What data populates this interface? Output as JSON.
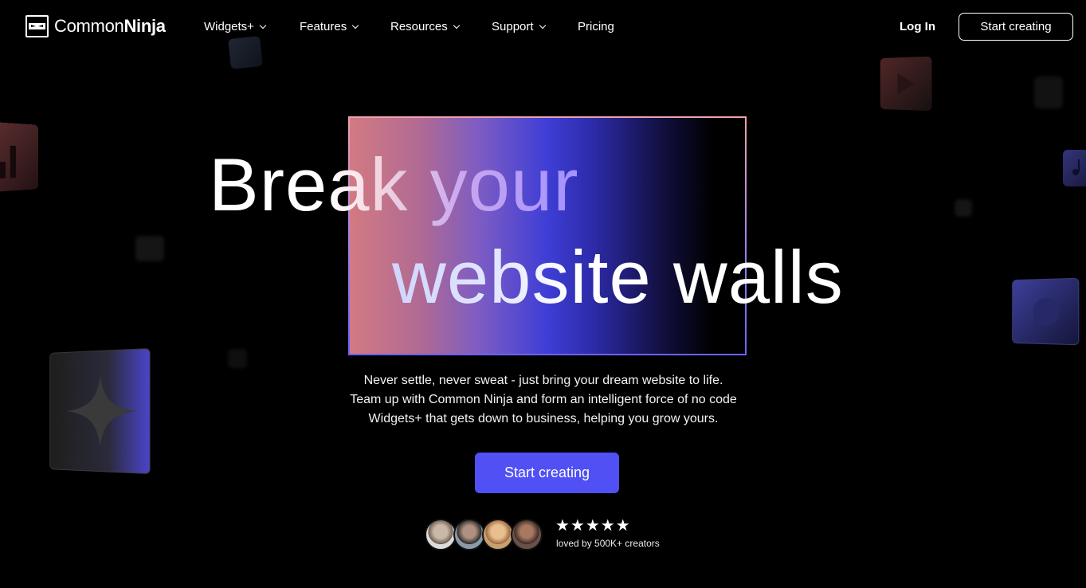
{
  "brand": {
    "name_light": "Common",
    "name_bold": "Ninja",
    "logo_icon": "ninja-mask-icon"
  },
  "nav": {
    "items": [
      {
        "label": "Widgets+",
        "has_dropdown": true
      },
      {
        "label": "Features",
        "has_dropdown": true
      },
      {
        "label": "Resources",
        "has_dropdown": true
      },
      {
        "label": "Support",
        "has_dropdown": true
      },
      {
        "label": "Pricing",
        "has_dropdown": false
      }
    ],
    "login_label": "Log In",
    "cta_label": "Start creating"
  },
  "hero": {
    "line1_solid": "Bre",
    "line1_fade": "ak your",
    "line2_fade": "website",
    "line2_solid": " walls",
    "subtitle_lines": [
      "Never settle, never sweat - just bring your dream website to life.",
      "Team up with Common Ninja and form an intelligent force of no code",
      "Widgets+ that gets down to business, helping you grow yours."
    ],
    "cta_label": "Start creating"
  },
  "social_proof": {
    "stars": "★★★★★",
    "rating": 5,
    "caption": "loved by 500K+ creators"
  },
  "colors": {
    "accent": "#5050f5",
    "background": "#000000",
    "text": "#ffffff"
  },
  "decor_icons": [
    "bar-chart-icon",
    "play-icon",
    "sparkle-icon",
    "chat-bubble-icon",
    "music-note-icon",
    "map-pin-icon"
  ]
}
